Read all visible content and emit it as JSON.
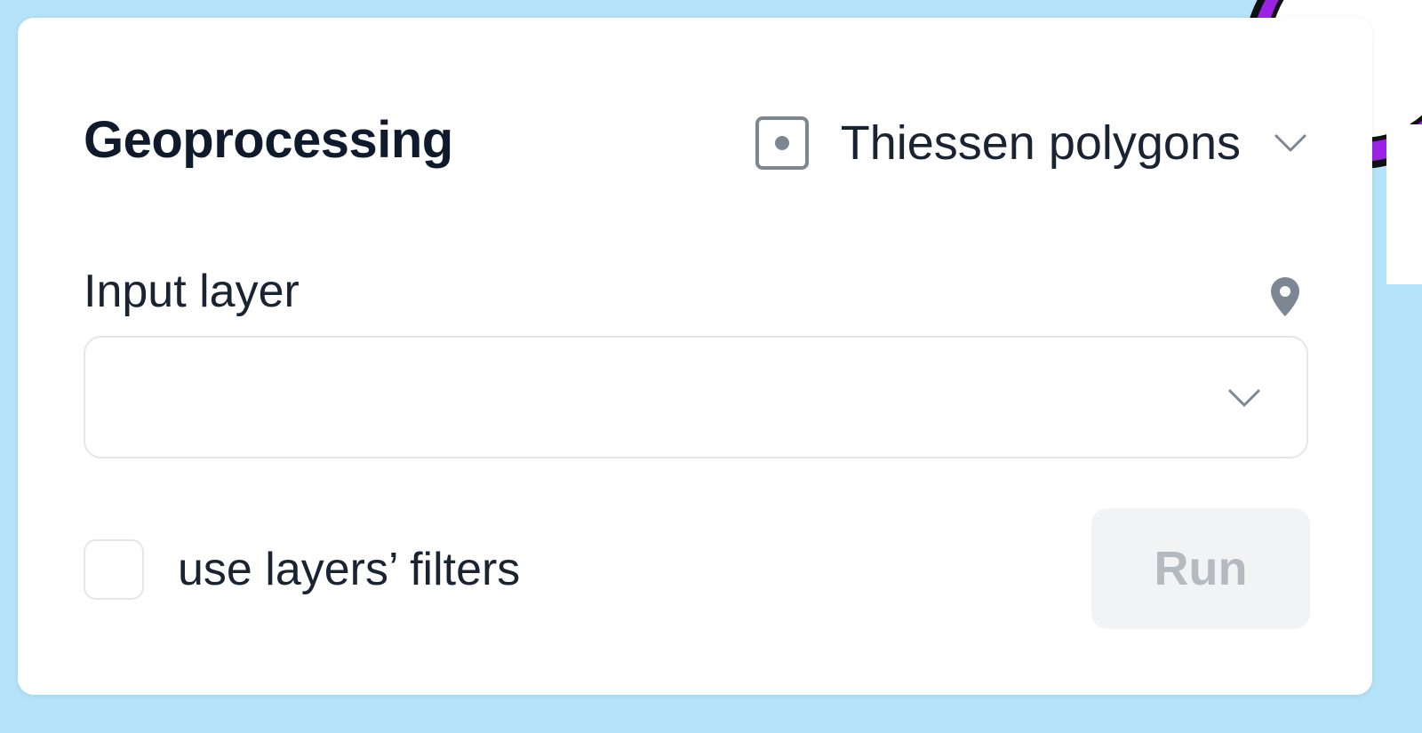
{
  "panel": {
    "title": "Geoprocessing",
    "tool": {
      "selected_label": "Thiessen polygons",
      "icon": "point-in-square-icon"
    }
  },
  "input_layer": {
    "label": "Input layer",
    "value": "",
    "icon": "map-pin-icon"
  },
  "options": {
    "use_filters_label": "use layers’ filters",
    "use_filters_checked": false
  },
  "actions": {
    "run_label": "Run",
    "run_disabled": true
  },
  "colors": {
    "title": "#0f1b2d",
    "text": "#1a2332",
    "icon_gray": "#7d8794",
    "border": "#e3e6ea",
    "button_disabled_bg": "#f2f3f4",
    "button_disabled_text": "#b5bac1",
    "map_water": "#b4e2f8",
    "map_accent": "#9b23e6"
  }
}
